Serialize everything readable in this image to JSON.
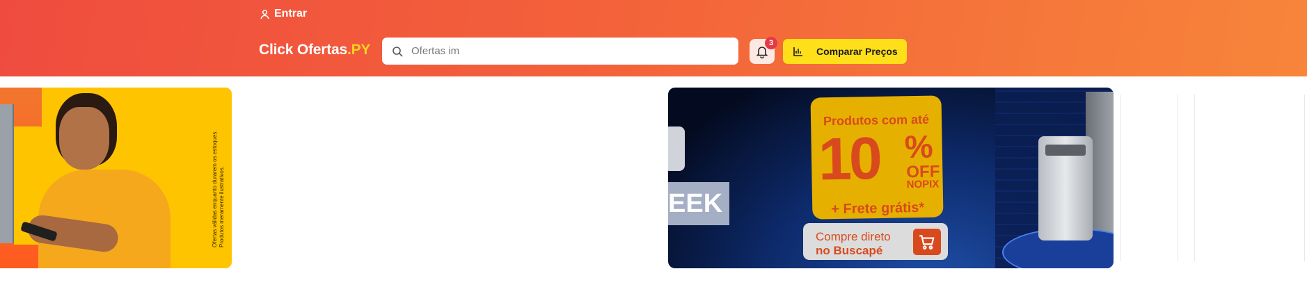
{
  "header": {
    "login_label": "Entrar",
    "logo_main": "Click Ofertas",
    "logo_accent": ".PY",
    "search": {
      "placeholder": "Ofertas im"
    },
    "notifications": {
      "count": "3"
    },
    "compare_label": "Comparar Preços"
  },
  "banners": [
    {
      "disclaimer": "Ofertas válidas enquanto durarem os estoques. Produtos meramente ilustrativos."
    },
    {
      "week_text": "EEK",
      "headline": "Produtos com até",
      "discount_number": "10",
      "discount_percent": "%",
      "off": "OFF",
      "nopix": "NOPIX",
      "shipping": "+ Frete grátis*",
      "cta_line1": "Compre direto",
      "cta_line2": "no Buscapé"
    }
  ],
  "colors": {
    "header_start": "#ef4c3f",
    "header_end": "#f7853a",
    "logo_accent": "#ffd21f",
    "compare_button": "#ffdf1a",
    "badge": "#e63946"
  },
  "icons": [
    "user-icon",
    "search-icon",
    "bell-icon",
    "bar-chart-icon",
    "cart-icon"
  ]
}
